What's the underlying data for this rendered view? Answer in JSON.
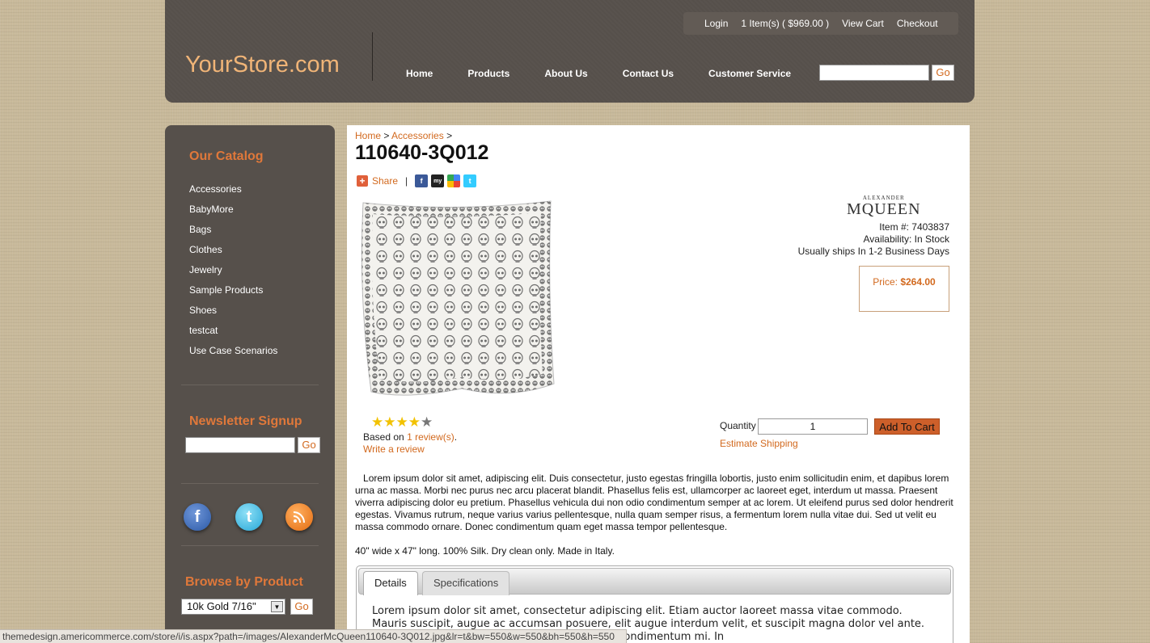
{
  "header": {
    "logo": "YourStore.com",
    "topbar": {
      "login": "Login",
      "cart_summary": "1 Item(s) ( $969.00 )",
      "view_cart": "View Cart",
      "checkout": "Checkout"
    },
    "nav": [
      "Home",
      "Products",
      "About Us",
      "Contact Us",
      "Customer Service"
    ],
    "search_go": "Go"
  },
  "sidebar": {
    "catalog_heading": "Our Catalog",
    "catalog_items": [
      "Accessories",
      "BabyMore",
      "Bags",
      "Clothes",
      "Jewelry",
      "Sample Products",
      "Shoes",
      "testcat",
      "Use Case Scenarios"
    ],
    "newsletter_heading": "Newsletter Signup",
    "newsletter_go": "Go",
    "social_icons": [
      "facebook-icon",
      "twitter-icon",
      "rss-icon"
    ],
    "browse_heading": "Browse by Product",
    "browse_selected": "10k Gold 7/16\"",
    "browse_go": "Go"
  },
  "breadcrumb": {
    "home": "Home",
    "sep1": ">",
    "category": "Accessories",
    "sep2": ">"
  },
  "product": {
    "title": "110640-3Q012",
    "share_label": "Share",
    "share_sep": "|",
    "brand_small": "ALEXANDER",
    "brand_big": "MQUEEN",
    "item_number": "Item #: 7403837",
    "availability": "Availability: In Stock",
    "shipping": "Usually ships In 1-2 Business Days",
    "price_label": "Price:",
    "price_value": "$264.00",
    "rating": 4,
    "rating_max": 5,
    "based_on": "Based on",
    "reviews_link": "1 review(s)",
    "reviews_period": ".",
    "write_review": "Write a review",
    "quantity_label": "Quantity",
    "quantity_value": "1",
    "add_to_cart": "Add To Cart",
    "estimate_shipping": "Estimate Shipping",
    "description": "Lorem ipsum dolor sit amet, adipiscing elit. Duis consectetur, justo egestas fringilla lobortis, justo enim sollicitudin enim, et dapibus lorem urna ac massa. Morbi nec purus nec arcu placerat blandit. Phasellus felis est, ullamcorper ac laoreet eget, interdum ut massa. Praesent viverra adipiscing dolor eu pretium. Phasellus vehicula dui non odio condimentum semper at ac lorem. Ut eleifend purus sed dolor hendrerit egestas. Vivamus rutrum, neque varius varius pellentesque, nulla quam semper risus, a fermentum lorem nulla vitae dui. Sed ut velit eu massa commodo ornare. Donec condimentum quam eget massa tempor pellentesque.",
    "dimensions": "40\" wide x 47\" long. 100% Silk. Dry clean only. Made in Italy."
  },
  "tabs": {
    "details": "Details",
    "specifications": "Specifications",
    "body": "Lorem ipsum dolor sit amet, consectetur adipiscing elit. Etiam auctor laoreet massa vitae commodo. Mauris suscipit, augue ac accumsan posuere, elit augue interdum velit, et suscipit magna dolor vel ante. Donec … t in at turpis. Nulla nec odio nibh, eu condimentum mi. In"
  },
  "status_url": "themedesign.americommerce.com/store/i/is.aspx?path=/images/AlexanderMcQueen110640-3Q012.jpg&lr=t&bw=550&w=550&bh=550&h=550",
  "colors": {
    "accent": "#d2691e",
    "header_bg": "#56504b",
    "page_bg": "#c8b99a",
    "cart_button": "#cd5f2a"
  }
}
